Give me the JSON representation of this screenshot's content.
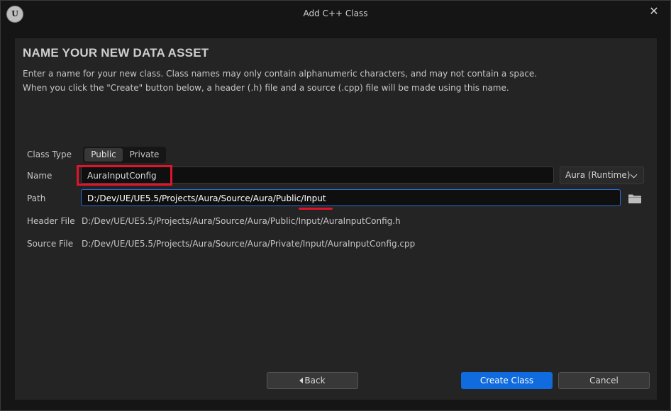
{
  "window": {
    "title": "Add C++ Class",
    "close_symbol": "✕"
  },
  "panel": {
    "heading": "NAME YOUR NEW DATA ASSET",
    "description_line1": "Enter a name for your new class. Class names may only contain alphanumeric characters, and may not contain a space.",
    "description_line2": "When you click the \"Create\" button below, a header (.h) file and a source (.cpp) file will be made using this name."
  },
  "form": {
    "class_type": {
      "label": "Class Type",
      "options": [
        "Public",
        "Private"
      ],
      "selected": "Public"
    },
    "name": {
      "label": "Name",
      "value": "AuraInputConfig",
      "module": "Aura (Runtime)"
    },
    "path": {
      "label": "Path",
      "value": "D:/Dev/UE/UE5.5/Projects/Aura/Source/Aura/Public/Input"
    },
    "header_file": {
      "label": "Header File",
      "value": "D:/Dev/UE/UE5.5/Projects/Aura/Source/Aura/Public/Input/AuraInputConfig.h"
    },
    "source_file": {
      "label": "Source File",
      "value": "D:/Dev/UE/UE5.5/Projects/Aura/Source/Aura/Private/Input/AuraInputConfig.cpp"
    }
  },
  "buttons": {
    "back": "Back",
    "create": "Create Class",
    "cancel": "Cancel"
  },
  "colors": {
    "accent": "#0f6bde",
    "annotation": "#e0142a",
    "panel_bg": "#242424"
  },
  "icons": [
    "unreal-logo-icon",
    "close-icon",
    "chevron-down-icon",
    "folder-icon",
    "back-arrow-icon"
  ]
}
